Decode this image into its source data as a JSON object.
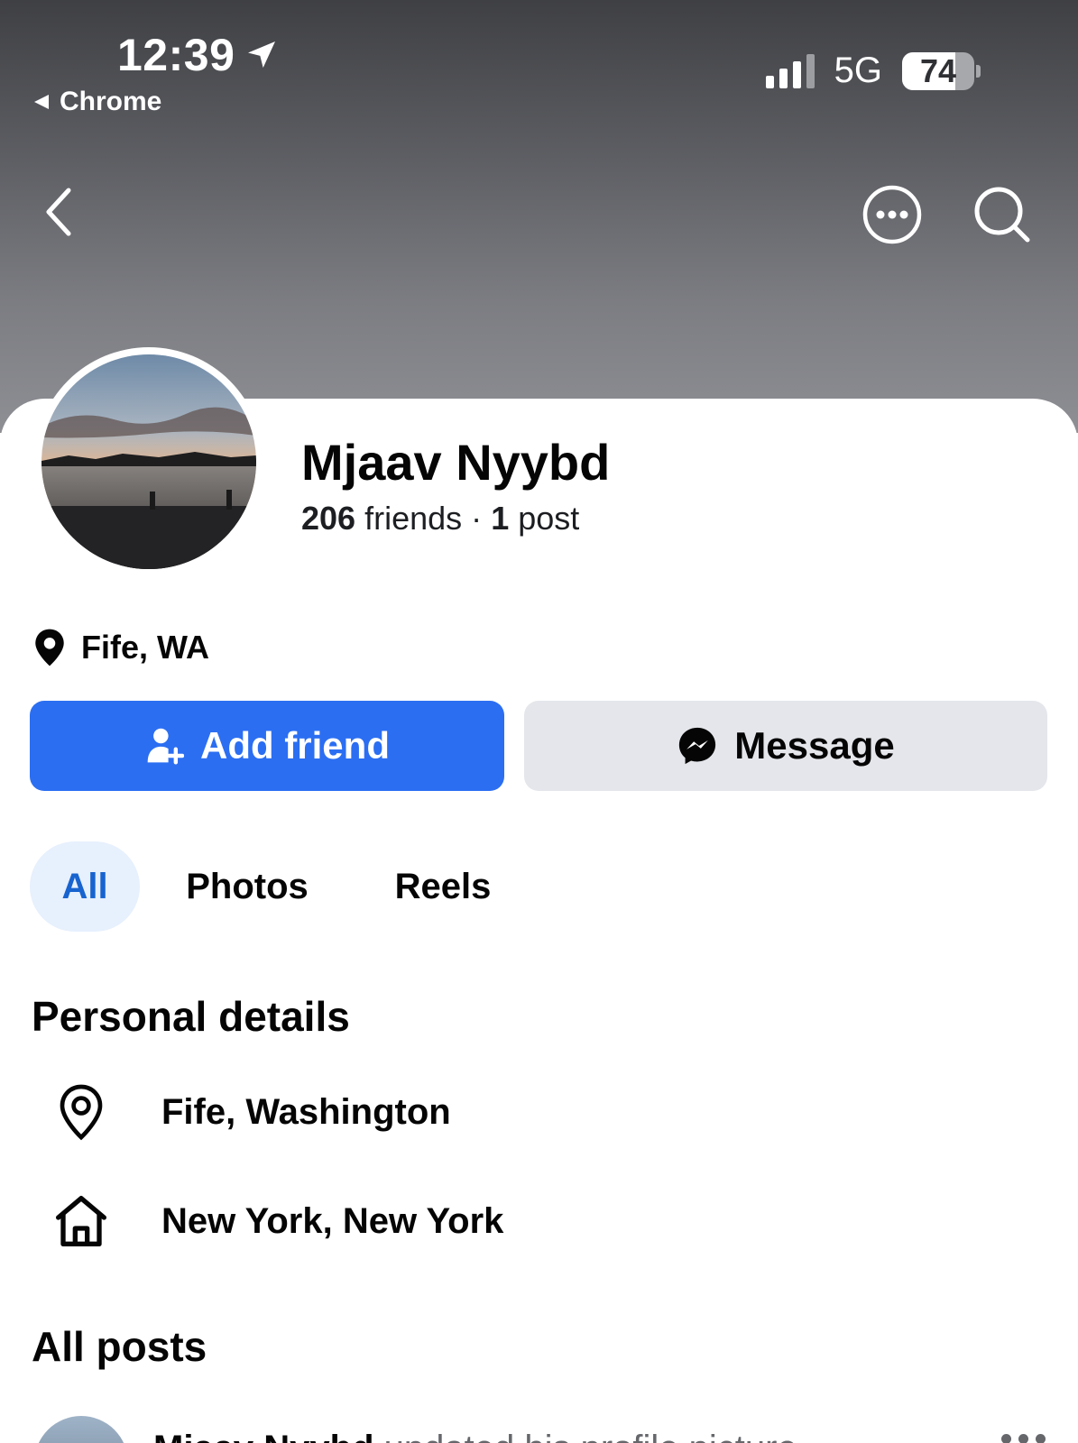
{
  "status_bar": {
    "time": "12:39",
    "back_app": "Chrome",
    "network": "5G",
    "battery_percent": "74"
  },
  "profile": {
    "name": "Mjaav Nyybd",
    "friends_count": "206",
    "friends_label": "friends",
    "separator": "·",
    "posts_count": "1",
    "posts_label": "post",
    "location": "Fife, WA"
  },
  "actions": {
    "add_friend_label": "Add friend",
    "message_label": "Message"
  },
  "tabs": [
    {
      "label": "All",
      "active": true
    },
    {
      "label": "Photos",
      "active": false
    },
    {
      "label": "Reels",
      "active": false
    }
  ],
  "personal_details": {
    "title": "Personal details",
    "items": [
      {
        "icon": "location-pin-icon",
        "text": "Fife, Washington"
      },
      {
        "icon": "home-icon",
        "text": "New York, New York"
      }
    ]
  },
  "posts": {
    "title": "All posts",
    "first_post_author": "Mjaav Nyybd",
    "first_post_action": "updated his profile picture."
  },
  "colors": {
    "primary_button": "#2b6ef2",
    "secondary_button": "#e4e6eb",
    "active_tab_bg": "#e7f0fd",
    "active_tab_text": "#1763cf"
  }
}
